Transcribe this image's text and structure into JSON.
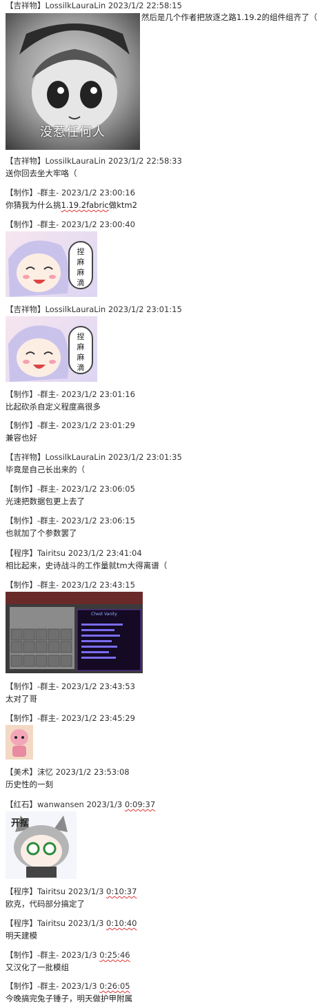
{
  "messages": [
    {
      "header": "【吉祥物】LossilkLauraLin 2023/1/2 22:58:15",
      "text": "然后是几个作者把放逐之路1.19.2的组件组齐了（",
      "image": {
        "kind": "sticker-gray",
        "caption": "没惹任何人"
      }
    },
    {
      "header": "【吉祥物】LossilkLauraLin 2023/1/2 22:58:33",
      "text": "送你回去坐大牢咯（"
    },
    {
      "header": "【制作】-群主- 2023/1/2 23:00:16",
      "text_pre": "你猜我为什么挑",
      "text_u": "1.19.2fabric",
      "text_post": "做ktm2"
    },
    {
      "header": "【制作】-群主- 2023/1/2 23:00:40",
      "image": {
        "kind": "sticker-pink",
        "bubble": [
          "捏",
          "麻",
          "麻",
          "滴"
        ]
      }
    },
    {
      "header": "【吉祥物】LossilkLauraLin 2023/1/2 23:01:15",
      "image": {
        "kind": "sticker-pink",
        "bubble": [
          "捏",
          "麻",
          "麻",
          "滴"
        ]
      }
    },
    {
      "header": "【制作】-群主- 2023/1/2 23:01:16",
      "text": "比起砍杀自定义程度高很多"
    },
    {
      "header": "【制作】-群主- 2023/1/2 23:01:29",
      "text": "兼容也好"
    },
    {
      "header": "【吉祥物】LossilkLauraLin 2023/1/2 23:01:35",
      "text": "毕竟是自己长出来的（"
    },
    {
      "header": "【制作】-群主- 2023/1/2 23:06:05",
      "text": "光速把数据包更上去了"
    },
    {
      "header": "【制作】-群主- 2023/1/2 23:06:15",
      "text": "也就加了个参数罢了"
    },
    {
      "header": "【程序】Tairitsu 2023/1/2 23:41:04",
      "text": "相比起来，史诗战斗的工作量就tm大得离谱（"
    },
    {
      "header": "【制作】-群主- 2023/1/2 23:43:15",
      "image": {
        "kind": "game-ui",
        "tooltip_title": "Chest Vanity"
      }
    },
    {
      "header": "【制作】-群主- 2023/1/2 23:43:53",
      "text": "太对了哥"
    },
    {
      "header": "【制作】-群主- 2023/1/2 23:45:29",
      "image": {
        "kind": "sticker-small"
      }
    },
    {
      "header": "【美术】沫忆 2023/1/2 23:53:08",
      "text": "历史性的一刻"
    },
    {
      "header_pre": "【红石】wanwansen 2023/1/3 ",
      "header_u": "0:09:37",
      "image": {
        "kind": "sticker-cat",
        "label": "开摆"
      }
    },
    {
      "header_pre": "【程序】Tairitsu 2023/1/3 ",
      "header_u": "0:10:37",
      "text": "欧克，代码部分搞定了"
    },
    {
      "header_pre": "【程序】Tairitsu 2023/1/3 ",
      "header_u": "0:10:40",
      "text": "明天建模"
    },
    {
      "header_pre": "【制作】-群主- 2023/1/3 ",
      "header_u": "0:25:46",
      "text": "又汉化了一批模组"
    },
    {
      "header_pre": "【制作】-群主- 2023/1/3 ",
      "header_u": "0:26:05",
      "text": "今晚搞完兔子锤子，明天做护甲附属"
    }
  ]
}
